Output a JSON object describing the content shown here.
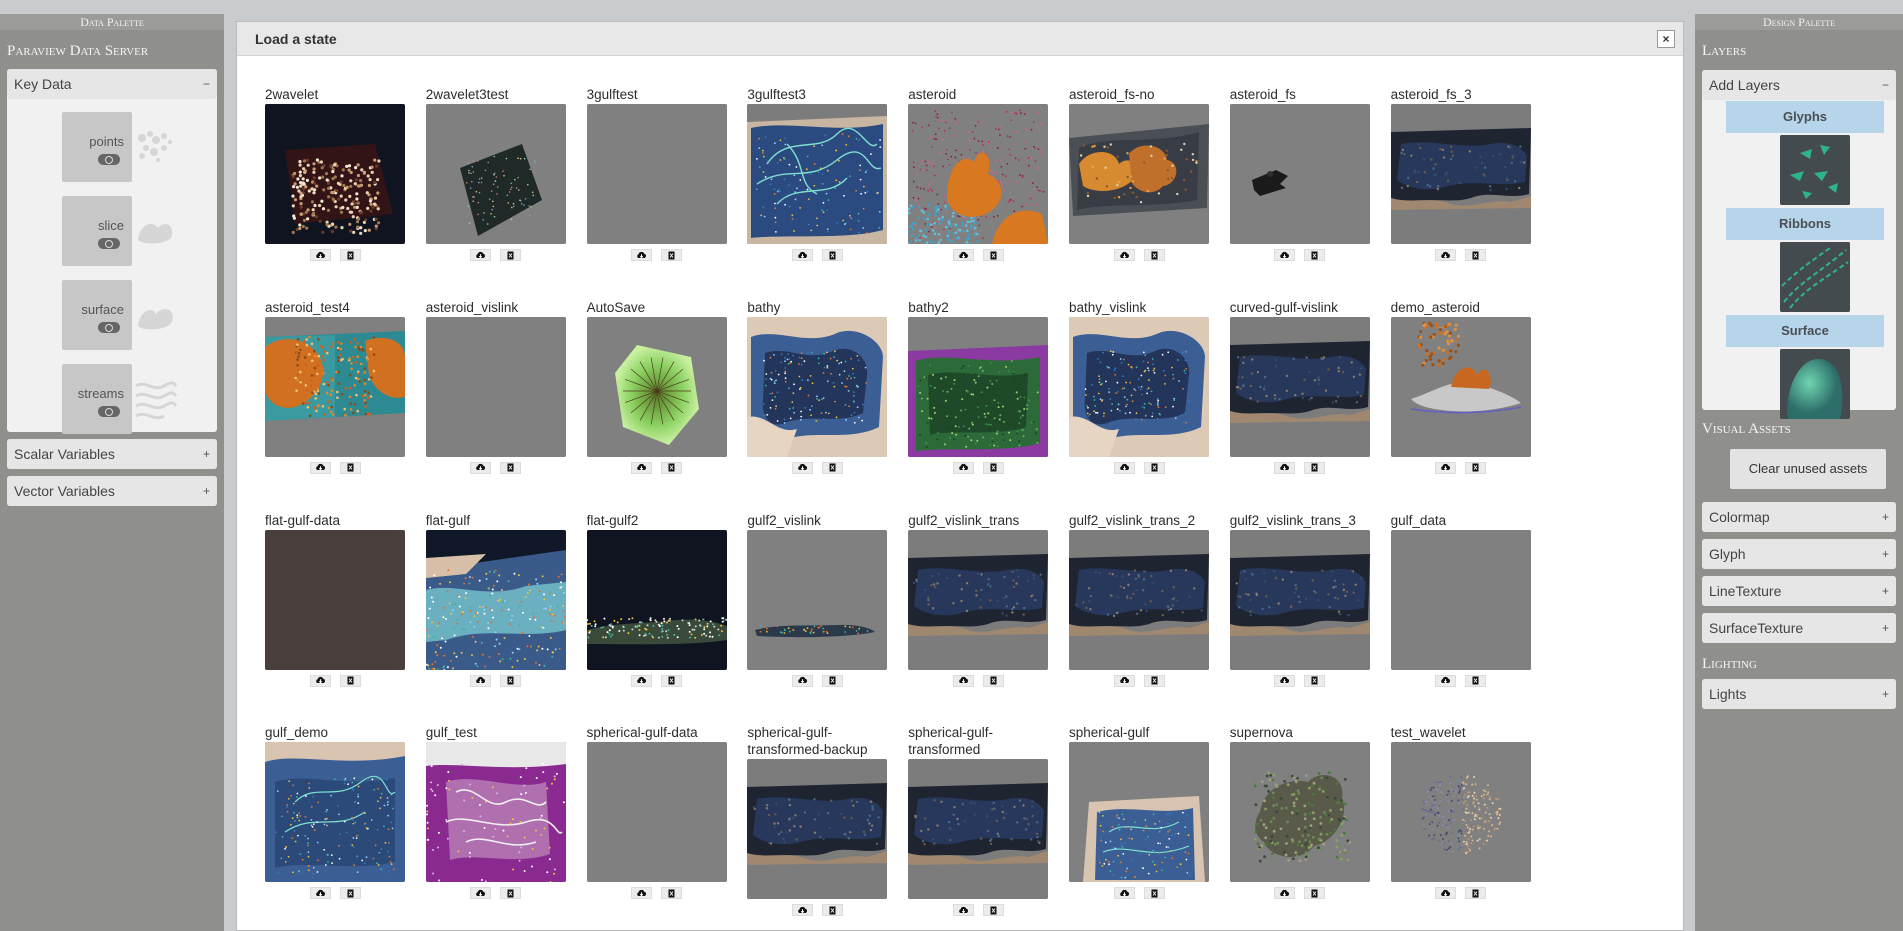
{
  "left_palette": {
    "header": "Data Palette",
    "server_title": "Paraview Data Server",
    "key_data": {
      "label": "Key Data",
      "toggle": "−"
    },
    "key_items": [
      {
        "label": "points",
        "icon": "points-glyph-icon"
      },
      {
        "label": "slice",
        "icon": "slice-glyph-icon"
      },
      {
        "label": "surface",
        "icon": "surface-glyph-icon"
      },
      {
        "label": "streams",
        "icon": "streams-glyph-icon"
      }
    ],
    "scalar_variables": {
      "label": "Scalar Variables",
      "toggle": "+"
    },
    "vector_variables": {
      "label": "Vector Variables",
      "toggle": "+"
    }
  },
  "right_palette": {
    "header": "Design Palette",
    "layers_title": "Layers",
    "add_layers": {
      "label": "Add Layers",
      "toggle": "−"
    },
    "layers": [
      {
        "label": "Glyphs"
      },
      {
        "label": "Ribbons"
      },
      {
        "label": "Surface"
      }
    ],
    "visual_assets_title": "Visual Assets",
    "clear_button": "Clear unused assets",
    "asset_panels": [
      {
        "label": "Colormap",
        "toggle": "+"
      },
      {
        "label": "Glyph",
        "toggle": "+"
      },
      {
        "label": "LineTexture",
        "toggle": "+"
      },
      {
        "label": "SurfaceTexture",
        "toggle": "+"
      }
    ],
    "lighting_title": "Lighting",
    "lights": {
      "label": "Lights",
      "toggle": "+"
    }
  },
  "dialog": {
    "title": "Load a state",
    "close_label": "×",
    "states": [
      {
        "name": "2wavelet",
        "thumb": "wavelet"
      },
      {
        "name": "2wavelet3test",
        "thumb": "box"
      },
      {
        "name": "3gulftest",
        "thumb": "empty"
      },
      {
        "name": "3gulftest3",
        "thumb": "gulf-flow"
      },
      {
        "name": "asteroid",
        "thumb": "asteroid"
      },
      {
        "name": "asteroid_fs-no",
        "thumb": "asteroid-fs"
      },
      {
        "name": "asteroid_fs",
        "thumb": "small-object"
      },
      {
        "name": "asteroid_fs_3",
        "thumb": "gulf-dark"
      },
      {
        "name": "asteroid_test4",
        "thumb": "asteroid-test"
      },
      {
        "name": "asteroid_vislink",
        "thumb": "empty"
      },
      {
        "name": "AutoSave",
        "thumb": "autosave"
      },
      {
        "name": "bathy",
        "thumb": "bathy"
      },
      {
        "name": "bathy2",
        "thumb": "bathy2"
      },
      {
        "name": "bathy_vislink",
        "thumb": "bathy"
      },
      {
        "name": "curved-gulf-vislink",
        "thumb": "gulf-dark"
      },
      {
        "name": "demo_asteroid",
        "thumb": "demo-asteroid"
      },
      {
        "name": "flat-gulf-data",
        "thumb": "brown"
      },
      {
        "name": "flat-gulf",
        "thumb": "flat-gulf"
      },
      {
        "name": "flat-gulf2",
        "thumb": "flat-gulf2"
      },
      {
        "name": "gulf2_vislink",
        "thumb": "thin-strip"
      },
      {
        "name": "gulf2_vislink_trans",
        "thumb": "gulf-dark"
      },
      {
        "name": "gulf2_vislink_trans_2",
        "thumb": "gulf-dark"
      },
      {
        "name": "gulf2_vislink_trans_3",
        "thumb": "gulf-dark"
      },
      {
        "name": "gulf_data",
        "thumb": "empty"
      },
      {
        "name": "gulf_demo",
        "thumb": "gulf-demo"
      },
      {
        "name": "gulf_test",
        "thumb": "gulf-test"
      },
      {
        "name": "spherical-gulf-data",
        "thumb": "empty"
      },
      {
        "name": "spherical-gulf-transformed-backup",
        "thumb": "gulf-dark"
      },
      {
        "name": "spherical-gulf-transformed",
        "thumb": "gulf-dark"
      },
      {
        "name": "spherical-gulf",
        "thumb": "spherical-gulf"
      },
      {
        "name": "supernova",
        "thumb": "supernova"
      },
      {
        "name": "test_wavelet",
        "thumb": "test-wavelet"
      }
    ],
    "actions": {
      "load_icon": "cloud-download-icon",
      "delete_icon": "delete-icon"
    }
  }
}
